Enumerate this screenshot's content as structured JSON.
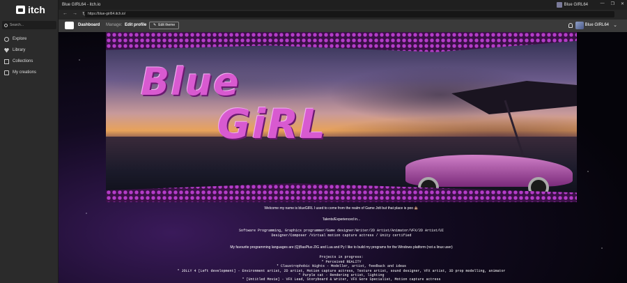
{
  "browser": {
    "window_title": "Blue GIRL64 - itch.io",
    "account_name": "Blue GIRL64",
    "controls": [
      "—",
      "❐",
      "✕"
    ],
    "url": "https://blue-girl64.itch.io/"
  },
  "sidebar": {
    "logo": "itch",
    "search_placeholder": "Search...",
    "items": [
      {
        "label": "Explore"
      },
      {
        "label": "Library"
      },
      {
        "label": "Collections"
      },
      {
        "label": "My creations"
      }
    ]
  },
  "header": {
    "dashboard": "Dashboard",
    "manage": "Manage:",
    "edit_profile": "Edit profile",
    "edit_theme": "Edit theme",
    "username": "Blue GIRL64"
  },
  "banner": {
    "title_line1": "Blue",
    "title_line2": "GiRL"
  },
  "profile": {
    "intro": "Welcome my name is blueGIRL I used to come from the realm of Game Jolt but that place is poo 💩",
    "talents_heading": "Talents/Experienced in...",
    "talents_1": "Software Programming, Graphics programmer/Game designer/Writer/2D Artist/Animator/VFX/2D Artist/UI",
    "talents_2": "Designer/Composer /Virtual motion capture actress / Unity certified",
    "languages": "My favourite programming languages are (Q)BasPlus ZIG and Lua and Py I like to build my programs for the Windows platform (not a linux user)",
    "projects_heading": "Projects in progress:",
    "project_1": "* Perceived REALITY",
    "project_2": "* Claustrophobic Nights - Modeller, artist, feedback and ideas",
    "project_3": "* JOLLY 4 [Left development] - Environment artist, 2D artist, Motion capture actress, Texture artist, sound designer, VFX artist, 3D prop modelling, animator",
    "project_4": "* Purple cat - Rendering artist, lighting",
    "project_5": "* [Untitled Movie] - VFX Lead, Storyboard & Writer, VFX Gore Specialist, Motion capture actress"
  }
}
